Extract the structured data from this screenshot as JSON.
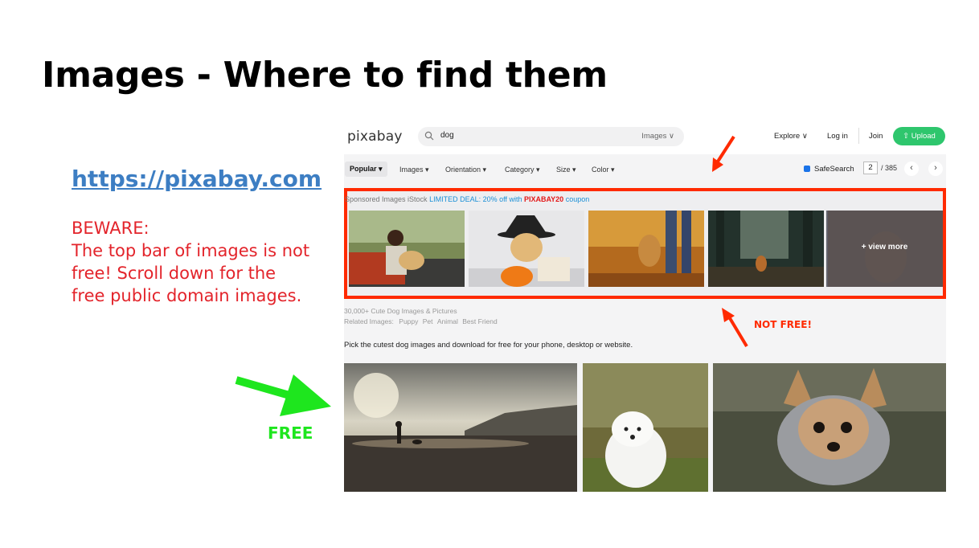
{
  "slide": {
    "title": "Images - Where to find them",
    "link": "https://pixabay.com",
    "warning_lines": [
      "BEWARE:",
      "The top bar of images is not",
      "free! Scroll down for the",
      "free public domain images."
    ],
    "not_free_label": "NOT FREE!",
    "free_label": "FREE"
  },
  "pixabay": {
    "logo": "pixabay",
    "search": {
      "query": "dog",
      "scope": "Images ∨"
    },
    "nav": {
      "explore": "Explore ∨",
      "login": "Log in",
      "join": "Join",
      "upload": "⇧ Upload"
    },
    "filters": {
      "popular": "Popular ▾",
      "images": "Images ▾",
      "orientation": "Orientation ▾",
      "category": "Category ▾",
      "size": "Size ▾",
      "color": "Color ▾"
    },
    "safesearch": "SafeSearch",
    "pagination": {
      "current": "2",
      "total": "/ 385",
      "prev": "‹",
      "next": "›"
    },
    "sponsored": {
      "label": "Sponsored Images iStock",
      "deal_prefix": "LIMITED DEAL: 20% off with",
      "code": "PIXABAY20",
      "deal_suffix": "coupon",
      "view_more": "+ view more"
    },
    "results": {
      "count": "30,000+ Cute Dog Images & Pictures",
      "related_prefix": "Related Images:",
      "related_tags": [
        "Puppy",
        "Pet",
        "Animal",
        "Best Friend"
      ],
      "tagline": "Pick the cutest dog images and download for free for your phone, desktop or website."
    }
  },
  "colors": {
    "sponsored_border": "#ff2a00",
    "free_arrow": "#1ee61e",
    "upload_button": "#2ec66d",
    "link": "#3d7ec3",
    "warning": "#e3242b"
  },
  "icons": [
    "search-icon",
    "arrow-icon"
  ]
}
